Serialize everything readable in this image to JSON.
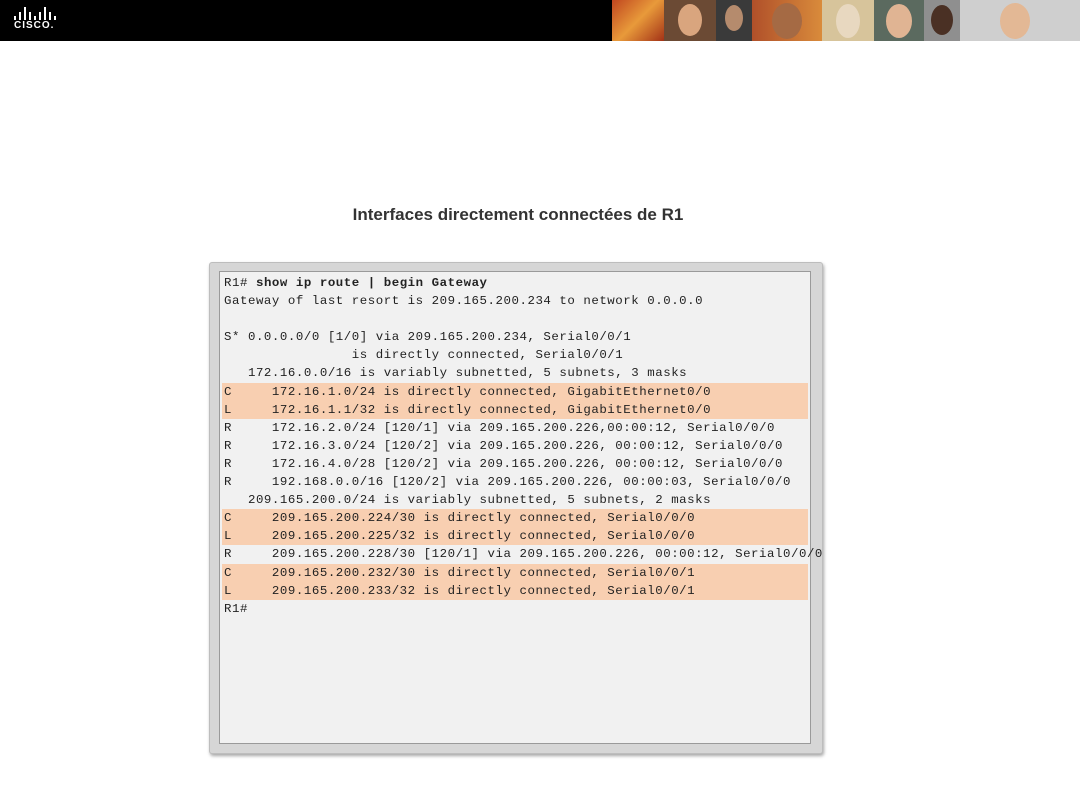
{
  "header": {
    "logo_text": "CISCO.",
    "photo_strip": [
      "portrait-1",
      "portrait-2",
      "portrait-3",
      "portrait-4",
      "portrait-5",
      "portrait-6",
      "portrait-7"
    ]
  },
  "slide": {
    "title": "Interfaces directement connectées de R1"
  },
  "terminal": {
    "prompt_line": {
      "prompt": "R1# ",
      "command": "show ip route | begin Gateway"
    },
    "lines": [
      {
        "text": "Gateway of last resort is 209.165.200.234 to network 0.0.0.0",
        "highlight": false
      },
      {
        "text": "",
        "highlight": false
      },
      {
        "text": "S* 0.0.0.0/0 [1/0] via 209.165.200.234, Serial0/0/1",
        "highlight": false
      },
      {
        "text": "                is directly connected, Serial0/0/1",
        "highlight": false
      },
      {
        "text": "   172.16.0.0/16 is variably subnetted, 5 subnets, 3 masks",
        "highlight": false
      },
      {
        "text": "C     172.16.1.0/24 is directly connected, GigabitEthernet0/0",
        "highlight": true
      },
      {
        "text": "L     172.16.1.1/32 is directly connected, GigabitEthernet0/0",
        "highlight": true
      },
      {
        "text": "R     172.16.2.0/24 [120/1] via 209.165.200.226,00:00:12, Serial0/0/0",
        "highlight": false
      },
      {
        "text": "R     172.16.3.0/24 [120/2] via 209.165.200.226, 00:00:12, Serial0/0/0",
        "highlight": false
      },
      {
        "text": "R     172.16.4.0/28 [120/2] via 209.165.200.226, 00:00:12, Serial0/0/0",
        "highlight": false
      },
      {
        "text": "R     192.168.0.0/16 [120/2] via 209.165.200.226, 00:00:03, Serial0/0/0",
        "highlight": false
      },
      {
        "text": "   209.165.200.0/24 is variably subnetted, 5 subnets, 2 masks",
        "highlight": false
      },
      {
        "text": "C     209.165.200.224/30 is directly connected, Serial0/0/0",
        "highlight": true
      },
      {
        "text": "L     209.165.200.225/32 is directly connected, Serial0/0/0",
        "highlight": true
      },
      {
        "text": "R     209.165.200.228/30 [120/1] via 209.165.200.226, 00:00:12, Serial0/0/0",
        "highlight": false
      },
      {
        "text": "C     209.165.200.232/30 is directly connected, Serial0/0/1",
        "highlight": true
      },
      {
        "text": "L     209.165.200.233/32 is directly connected, Serial0/0/1",
        "highlight": true
      },
      {
        "text": "R1#",
        "highlight": false
      }
    ],
    "colors": {
      "highlight": "#f8cfb1",
      "screen": "#f1f1f1"
    }
  }
}
